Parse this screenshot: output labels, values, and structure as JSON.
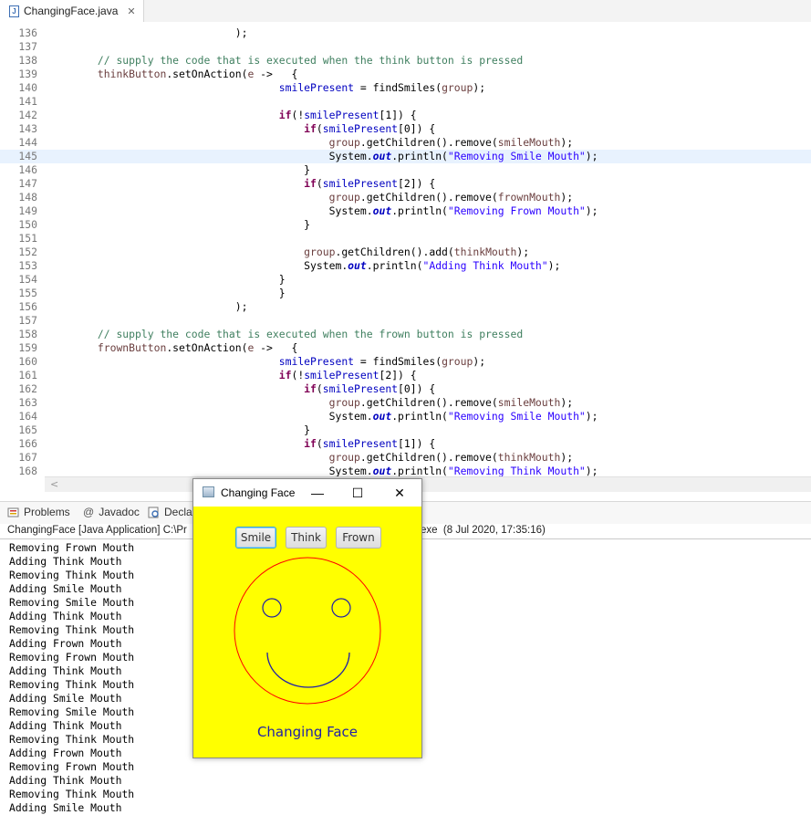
{
  "editor": {
    "tab_title": "ChangingFace.java",
    "tab_icon": "java-file-icon",
    "close_icon": "close-icon",
    "lines": [
      {
        "n": "136",
        "t": [
          [
            "p",
            "                              );"
          ]
        ]
      },
      {
        "n": "137",
        "t": []
      },
      {
        "n": "138",
        "t": [
          [
            "p",
            "        "
          ],
          [
            "c",
            "// supply the code that is executed when the think button is pressed"
          ]
        ]
      },
      {
        "n": "139",
        "t": [
          [
            "p",
            "        "
          ],
          [
            "v",
            "thinkButton"
          ],
          [
            "p",
            ".setOnAction("
          ],
          [
            "v",
            "e"
          ],
          [
            "p",
            " ->   {"
          ]
        ]
      },
      {
        "n": "140",
        "t": [
          [
            "p",
            "                                     "
          ],
          [
            "f",
            "smilePresent"
          ],
          [
            "p",
            " = findSmiles("
          ],
          [
            "v",
            "group"
          ],
          [
            "p",
            ");"
          ]
        ]
      },
      {
        "n": "141",
        "t": []
      },
      {
        "n": "142",
        "t": [
          [
            "p",
            "                                     "
          ],
          [
            "k",
            "if"
          ],
          [
            "p",
            "(!"
          ],
          [
            "f",
            "smilePresent"
          ],
          [
            "p",
            "[1]) {"
          ]
        ]
      },
      {
        "n": "143",
        "t": [
          [
            "p",
            "                                         "
          ],
          [
            "k",
            "if"
          ],
          [
            "p",
            "("
          ],
          [
            "f",
            "smilePresent"
          ],
          [
            "p",
            "[0]) {"
          ]
        ]
      },
      {
        "n": "144",
        "t": [
          [
            "p",
            "                                             "
          ],
          [
            "v",
            "group"
          ],
          [
            "p",
            ".getChildren().remove("
          ],
          [
            "v",
            "smileMouth"
          ],
          [
            "p",
            ");"
          ]
        ]
      },
      {
        "n": "145",
        "t": [
          [
            "p",
            "                                             System."
          ],
          [
            "sf",
            "out"
          ],
          [
            "p",
            ".println("
          ],
          [
            "s",
            "\"Removing Smile Mouth\""
          ],
          [
            "p",
            ");"
          ]
        ],
        "hl": true
      },
      {
        "n": "146",
        "t": [
          [
            "p",
            "                                         }"
          ]
        ]
      },
      {
        "n": "147",
        "t": [
          [
            "p",
            "                                         "
          ],
          [
            "k",
            "if"
          ],
          [
            "p",
            "("
          ],
          [
            "f",
            "smilePresent"
          ],
          [
            "p",
            "[2]) {"
          ]
        ]
      },
      {
        "n": "148",
        "t": [
          [
            "p",
            "                                             "
          ],
          [
            "v",
            "group"
          ],
          [
            "p",
            ".getChildren().remove("
          ],
          [
            "v",
            "frownMouth"
          ],
          [
            "p",
            ");"
          ]
        ]
      },
      {
        "n": "149",
        "t": [
          [
            "p",
            "                                             System."
          ],
          [
            "sf",
            "out"
          ],
          [
            "p",
            ".println("
          ],
          [
            "s",
            "\"Removing Frown Mouth\""
          ],
          [
            "p",
            ");"
          ]
        ]
      },
      {
        "n": "150",
        "t": [
          [
            "p",
            "                                         }"
          ]
        ]
      },
      {
        "n": "151",
        "t": []
      },
      {
        "n": "152",
        "t": [
          [
            "p",
            "                                         "
          ],
          [
            "v",
            "group"
          ],
          [
            "p",
            ".getChildren().add("
          ],
          [
            "v",
            "thinkMouth"
          ],
          [
            "p",
            ");"
          ]
        ]
      },
      {
        "n": "153",
        "t": [
          [
            "p",
            "                                         System."
          ],
          [
            "sf",
            "out"
          ],
          [
            "p",
            ".println("
          ],
          [
            "s",
            "\"Adding Think Mouth\""
          ],
          [
            "p",
            ");"
          ]
        ]
      },
      {
        "n": "154",
        "t": [
          [
            "p",
            "                                     }"
          ]
        ]
      },
      {
        "n": "155",
        "t": [
          [
            "p",
            "                                     }"
          ]
        ]
      },
      {
        "n": "156",
        "t": [
          [
            "p",
            "                              );"
          ]
        ]
      },
      {
        "n": "157",
        "t": []
      },
      {
        "n": "158",
        "t": [
          [
            "p",
            "        "
          ],
          [
            "c",
            "// supply the code that is executed when the frown button is pressed"
          ]
        ]
      },
      {
        "n": "159",
        "t": [
          [
            "p",
            "        "
          ],
          [
            "v",
            "frownButton"
          ],
          [
            "p",
            ".setOnAction("
          ],
          [
            "v",
            "e"
          ],
          [
            "p",
            " ->   {"
          ]
        ]
      },
      {
        "n": "160",
        "t": [
          [
            "p",
            "                                     "
          ],
          [
            "f",
            "smilePresent"
          ],
          [
            "p",
            " = findSmiles("
          ],
          [
            "v",
            "group"
          ],
          [
            "p",
            ");"
          ]
        ]
      },
      {
        "n": "161",
        "t": [
          [
            "p",
            "                                     "
          ],
          [
            "k",
            "if"
          ],
          [
            "p",
            "(!"
          ],
          [
            "f",
            "smilePresent"
          ],
          [
            "p",
            "[2]) {"
          ]
        ]
      },
      {
        "n": "162",
        "t": [
          [
            "p",
            "                                         "
          ],
          [
            "k",
            "if"
          ],
          [
            "p",
            "("
          ],
          [
            "f",
            "smilePresent"
          ],
          [
            "p",
            "[0]) {"
          ]
        ]
      },
      {
        "n": "163",
        "t": [
          [
            "p",
            "                                             "
          ],
          [
            "v",
            "group"
          ],
          [
            "p",
            ".getChildren().remove("
          ],
          [
            "v",
            "smileMouth"
          ],
          [
            "p",
            ");"
          ]
        ]
      },
      {
        "n": "164",
        "t": [
          [
            "p",
            "                                             System."
          ],
          [
            "sf",
            "out"
          ],
          [
            "p",
            ".println("
          ],
          [
            "s",
            "\"Removing Smile Mouth\""
          ],
          [
            "p",
            ");"
          ]
        ]
      },
      {
        "n": "165",
        "t": [
          [
            "p",
            "                                         }"
          ]
        ]
      },
      {
        "n": "166",
        "t": [
          [
            "p",
            "                                         "
          ],
          [
            "k",
            "if"
          ],
          [
            "p",
            "("
          ],
          [
            "f",
            "smilePresent"
          ],
          [
            "p",
            "[1]) {"
          ]
        ]
      },
      {
        "n": "167",
        "t": [
          [
            "p",
            "                                             "
          ],
          [
            "v",
            "group"
          ],
          [
            "p",
            ".getChildren().remove("
          ],
          [
            "v",
            "thinkMouth"
          ],
          [
            "p",
            ");"
          ]
        ]
      },
      {
        "n": "168",
        "t": [
          [
            "p",
            "                                             System."
          ],
          [
            "sf",
            "out"
          ],
          [
            "p",
            ".println("
          ],
          [
            "s",
            "\"Removing Think Mouth\""
          ],
          [
            "p",
            ");"
          ]
        ]
      }
    ]
  },
  "views": {
    "tabs": [
      {
        "label": "Problems",
        "icon": "problems-icon"
      },
      {
        "label": "Javadoc",
        "icon": "javadoc-icon"
      },
      {
        "label": "Declar",
        "icon": "declaration-icon"
      }
    ]
  },
  "console": {
    "header_left": "ChangingFace [Java Application] C:\\Pr",
    "header_right": "exe  (8 Jul 2020, 17:35:16)",
    "lines": [
      "Removing Frown Mouth",
      "Adding Think Mouth",
      "Removing Think Mouth",
      "Adding Smile Mouth",
      "Removing Smile Mouth",
      "Adding Think Mouth",
      "Removing Think Mouth",
      "Adding Frown Mouth",
      "Removing Frown Mouth",
      "Adding Think Mouth",
      "Removing Think Mouth",
      "Adding Smile Mouth",
      "Removing Smile Mouth",
      "Adding Think Mouth",
      "Removing Think Mouth",
      "Adding Frown Mouth",
      "Removing Frown Mouth",
      "Adding Think Mouth",
      "Removing Think Mouth",
      "Adding Smile Mouth"
    ]
  },
  "app_window": {
    "title": "Changing Face",
    "minimize_glyph": "—",
    "maximize_glyph": "☐",
    "close_glyph": "✕",
    "buttons": {
      "smile": "Smile",
      "think": "Think",
      "frown": "Frown"
    },
    "caption": "Changing Face",
    "colors": {
      "background": "#ffff00",
      "face_outline": "#ff0000",
      "features": "#1f1fa8"
    }
  }
}
